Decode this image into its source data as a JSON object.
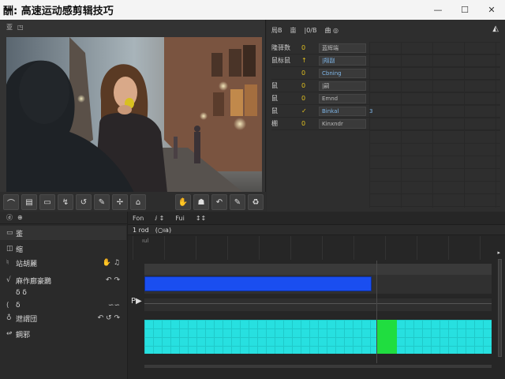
{
  "window": {
    "title": "酬: 高速运动感剪辑技巧",
    "minimize": "—",
    "maximize": "☐",
    "close": "✕"
  },
  "viewer": {
    "header_items": [
      "亚",
      "◳"
    ]
  },
  "viewer_tools": {
    "left": [
      "⌒",
      "▤",
      "▭",
      "↯",
      "↺",
      "✎",
      "✢",
      "⌂"
    ],
    "right": [
      "✋",
      "☗",
      "↶",
      "✎",
      "♻"
    ]
  },
  "inspector": {
    "header": [
      "局B",
      "亩",
      "|0/B",
      "曲 ◎"
    ],
    "corner_icon": "◭",
    "rows": [
      {
        "label": "隆驿数",
        "value": "0",
        "prop": "蓝辉端",
        "extra": "",
        "plain": true
      },
      {
        "label": "鼠标鼠",
        "value": "↑",
        "prop": "|翔副",
        "extra": "",
        "plain": false
      },
      {
        "label": "",
        "value": "0",
        "prop": "Cbning",
        "extra": "",
        "plain": false
      },
      {
        "label": "鼠",
        "value": "0",
        "prop": "|嗣",
        "extra": "",
        "plain": true
      },
      {
        "label": "鼠",
        "value": "0",
        "prop": "Emnd",
        "extra": "",
        "plain": true
      },
      {
        "label": "鼠",
        "value": "✓",
        "prop": "Binkal",
        "extra": "3",
        "plain": false
      },
      {
        "label": "棚",
        "value": "0",
        "prop": "Kinxndr",
        "extra": "",
        "plain": true
      }
    ]
  },
  "tracks": {
    "header": [
      "ⓓ",
      "⊕"
    ],
    "items": [
      {
        "icon": "▭",
        "label": "鉴",
        "right": ""
      },
      {
        "icon": "◫",
        "label": "缩",
        "right": ""
      },
      {
        "icon": "♮",
        "label": "站胡麗",
        "right": "✋ ♫"
      },
      {
        "icon": "√",
        "label": "麻作廊豪鸝",
        "right": "↶ ↷"
      },
      {
        "icon": "",
        "label": "δ δ",
        "right": ""
      },
      {
        "icon": "(",
        "label": "δ",
        "right": "∽∽"
      },
      {
        "icon": "♁",
        "label": "迣謂団",
        "right": "↶ ↺ ↷"
      },
      {
        "icon": "↫",
        "label": "鋼邪",
        "right": ""
      }
    ]
  },
  "timeline": {
    "header": [
      "Fon",
      "ⅈ ↕",
      "Fui",
      "↕↕"
    ],
    "tabs": [
      "1 rod",
      "(○ıa)"
    ],
    "ruler_label": "ıul",
    "playback_label": "P▶",
    "scroll_arrow": "▸"
  }
}
